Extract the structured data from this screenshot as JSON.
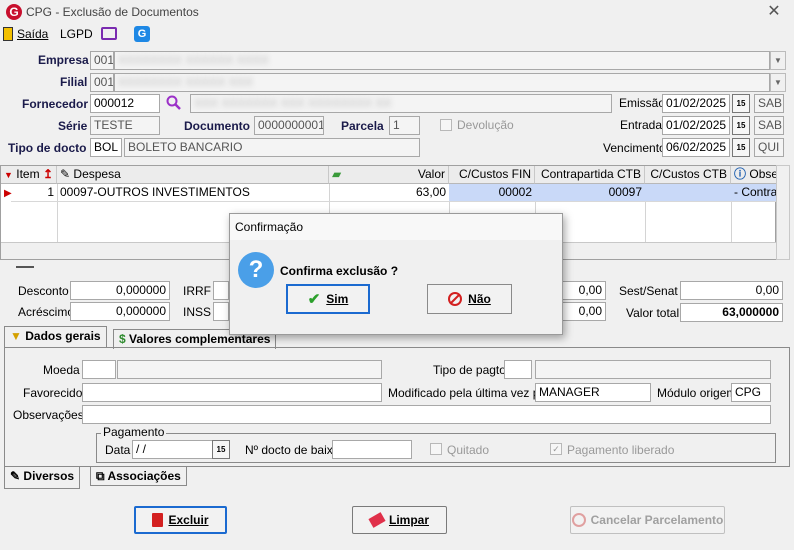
{
  "window": {
    "title": "CPG - Exclusão de Documentos",
    "logo": "G"
  },
  "toolbar": {
    "saida": "Saída",
    "lgpd": "LGPD"
  },
  "header": {
    "empresa_label": "Empresa",
    "empresa_code": "001",
    "filial_label": "Filial",
    "filial_code": "001",
    "fornecedor_label": "Fornecedor",
    "fornecedor_code": "000012",
    "emissao_label": "Emissão",
    "emissao_value": "01/02/2025",
    "emissao_day": "SAB",
    "serie_label": "Série",
    "serie_value": "TESTE",
    "documento_label": "Documento",
    "documento_value": "0000000001",
    "parcela_label": "Parcela",
    "parcela_value": "1",
    "devolucao_label": "Devolução",
    "entrada_label": "Entrada",
    "entrada_value": "01/02/2025",
    "entrada_day": "SAB",
    "tipo_docto_label": "Tipo de docto",
    "tipo_docto_code": "BOL",
    "tipo_docto_desc": "BOLETO BANCARIO",
    "vencimento_label": "Vencimento",
    "vencimento_value": "06/02/2025",
    "vencimento_day": "QUI"
  },
  "grid": {
    "headers": [
      "Item",
      "Despesa",
      "Valor",
      "C/Custos FIN",
      "Contrapartida CTB",
      "C/Custos CTB",
      "Obse"
    ],
    "rows": [
      {
        "item": "1",
        "despesa": "00097-OUTROS INVESTIMENTOS",
        "valor": "63,00",
        "ccfin": "00002",
        "contrapartida": "00097",
        "ccctb": "",
        "obs": "- Contrap"
      }
    ]
  },
  "totals": {
    "desconto_label": "Desconto",
    "desconto_value": "0,000000",
    "irrf_label": "IRRF",
    "acrescimo_label": "Acréscimo",
    "acrescimo_value": "0,000000",
    "inss_label": "INSS",
    "mid1_value": "0,00",
    "mid2_value": "0,00",
    "sest_label": "Sest/Senat",
    "sest_value": "0,00",
    "valor_total_label": "Valor total",
    "valor_total_value": "63,000000"
  },
  "tabs": {
    "dados_gerais": "Dados gerais",
    "valores_complementares": "Valores complementares"
  },
  "dados": {
    "moeda_label": "Moeda",
    "tipo_pagto_label": "Tipo de pagto",
    "favorecido_label": "Favorecido",
    "modificado_label": "Modificado pela última vez por",
    "modificado_value": "MANAGER",
    "modulo_label": "Módulo origem",
    "modulo_value": "CPG",
    "observacoes_label": "Observações",
    "pagamento_group": "Pagamento",
    "data_label": "Data",
    "data_value": " /  /",
    "ndocto_label": "Nº docto de baixa",
    "quitado_label": "Quitado",
    "pagamento_liberado_label": "Pagamento liberado"
  },
  "bottom_tabs": {
    "diversos": "Diversos",
    "associacoes": "Associações"
  },
  "buttons": {
    "excluir": "Excluir",
    "limpar": "Limpar",
    "cancelar_parcelamento": "Cancelar Parcelamento"
  },
  "dialog": {
    "title": "Confirmação",
    "message": "Confirma exclusão ?",
    "yes": "Sim",
    "no": "Não"
  }
}
